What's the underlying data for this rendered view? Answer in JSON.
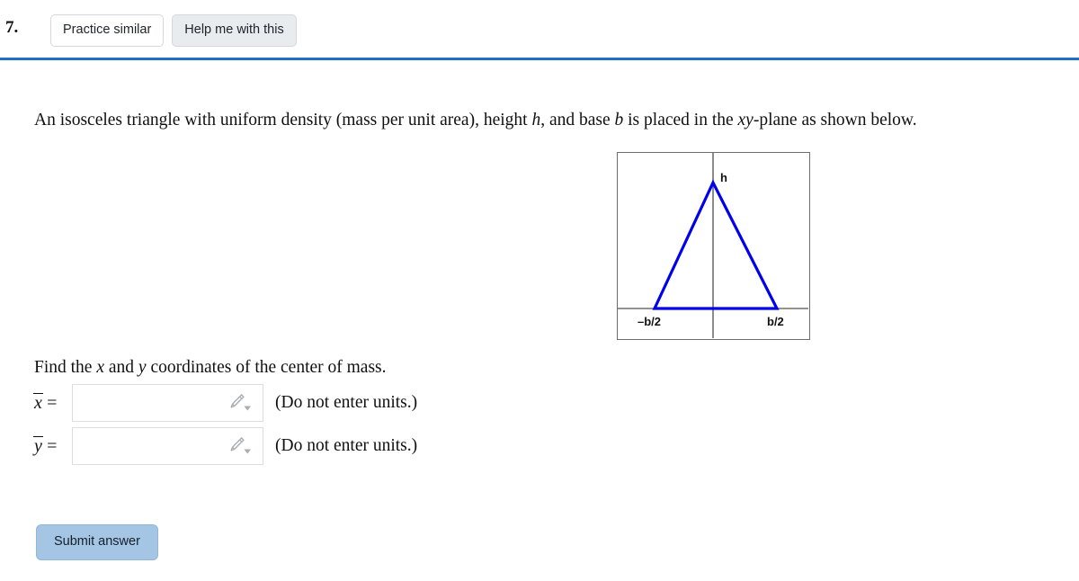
{
  "header": {
    "question_number": "7.",
    "practice_similar_label": "Practice similar",
    "help_label": "Help me with this",
    "rule_color": "#1f6fc4"
  },
  "problem": {
    "statement_part1": "An isosceles triangle with uniform density (mass per unit area), height ",
    "var_h": "h",
    "statement_part2": ", and base ",
    "var_b": "b",
    "statement_part3": " is placed in the ",
    "var_xy": "xy",
    "statement_part4": "-plane as shown below."
  },
  "figure": {
    "apex_label": "h",
    "left_base_label": "–b/2",
    "right_base_label": "b/2",
    "triangle_color": "#0000ee",
    "axis_color": "#6e6e6e",
    "border_color": "#6e6e6e"
  },
  "prompt": {
    "find_part1": "Find the ",
    "find_x": "x",
    "find_part2": " and ",
    "find_y": "y",
    "find_part3": " coordinates of the center of mass."
  },
  "answers": [
    {
      "label_var": "x",
      "label_eq": "=",
      "value": "",
      "placeholder": "",
      "note": "(Do not enter units.)",
      "icon": "pencil-icon"
    },
    {
      "label_var": "y",
      "label_eq": "=",
      "value": "",
      "placeholder": "",
      "note": "(Do not enter units.)",
      "icon": "pencil-icon"
    }
  ],
  "submit": {
    "label": "Submit answer",
    "color": "#a4c5e3"
  }
}
